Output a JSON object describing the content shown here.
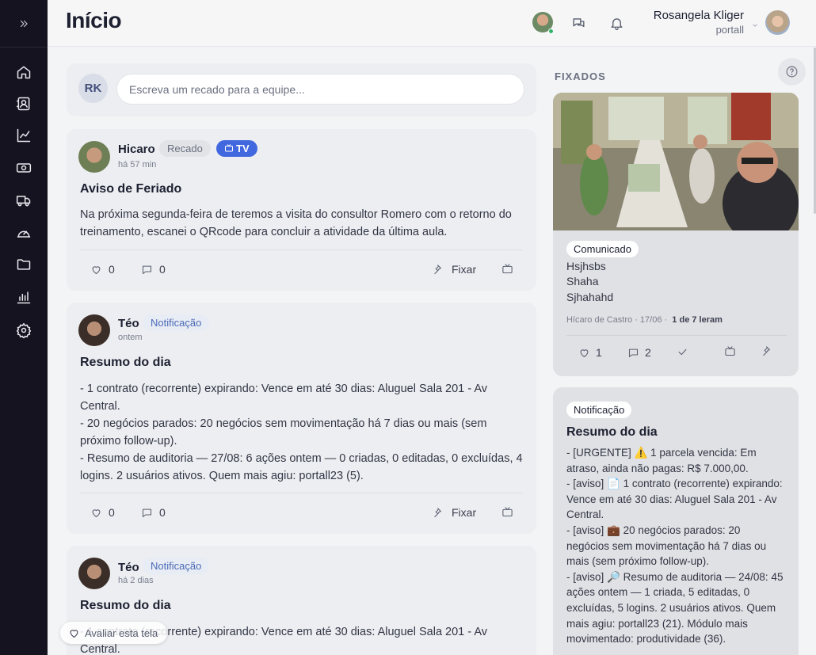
{
  "sidebar": {
    "toggle_icon": "double-chevron-right-icon",
    "items": [
      "home-icon",
      "contacts-icon",
      "chart-line-icon",
      "money-icon",
      "truck-icon",
      "dashboard-icon",
      "folder-icon",
      "bar-chart-icon",
      "gear-icon"
    ]
  },
  "header": {
    "title": "Início",
    "user_name": "Rosangela Kliger",
    "user_org": "portall"
  },
  "composer": {
    "initials": "RK",
    "placeholder": "Escreva um recado para a equipe..."
  },
  "posts": [
    {
      "author": "Hicaro",
      "type": "Recado",
      "badge": "TV",
      "time": "há 57 min",
      "title": "Aviso de Feriado",
      "body": "Na próxima segunda-feira de teremos a visita do consultor Romero com o retorno do treinamento, escanei o QRcode para concluir a atividade da última aula.",
      "likes": "0",
      "comments": "0",
      "pin_label": "Fixar"
    },
    {
      "author": "Téo",
      "type": "Notificação",
      "time": "ontem",
      "title": "Resumo do dia",
      "body_lines": [
        "- 1 contrato (recorrente) expirando: Vence em até 30 dias: Aluguel Sala 201 - Av Central.",
        "- 20 negócios parados: 20 negócios sem movimentação há 7 dias ou mais (sem próximo follow-up).",
        "- Resumo de auditoria — 27/08: 6 ações ontem — 0 criadas, 0 editadas, 0 excluídas, 4 logins. 2 usuários ativos. Quem mais agiu: portall23 (5)."
      ],
      "likes": "0",
      "comments": "0",
      "pin_label": "Fixar"
    },
    {
      "author": "Téo",
      "type": "Notificação",
      "time": "há 2 dias",
      "title": "Resumo do dia",
      "body": "- 1 contrato (recorrente) expirando: Vence em até 30 dias: Aluguel Sala 201 - Av Central."
    }
  ],
  "fixados": {
    "title": "FIXADOS",
    "pinned": [
      {
        "tag": "Comunicado",
        "lines": [
          "Hsjhsbs",
          "Shaha",
          "Sjhahahd"
        ],
        "meta": "Hícaro de Castro · 17/06 ·",
        "read": "1 de 7 leram",
        "likes": "1",
        "comments": "2"
      },
      {
        "tag": "Notificação",
        "title": "Resumo do dia",
        "body_lines": [
          "- [URGENTE] ⚠️ 1 parcela vencida: Em atraso, ainda não pagas: R$ 7.000,00.",
          "- [aviso] 📄 1 contrato (recorrente) expirando: Vence em até 30 dias: Aluguel Sala 201 - Av Central.",
          "- [aviso] 💼 20 negócios parados: 20 negócios sem movimentação há 7 dias ou mais (sem próximo follow-up).",
          "- [aviso] 🔎 Resumo de auditoria — 24/08: 45 ações ontem — 1 criada, 5 editadas, 0 excluídas, 5 logins. 2 usuários ativos. Quem mais agiu: portall23 (21). Módulo mais movimentado: produtividade (36)."
        ]
      }
    ]
  },
  "feedback": {
    "label": "Avaliar esta tela"
  }
}
